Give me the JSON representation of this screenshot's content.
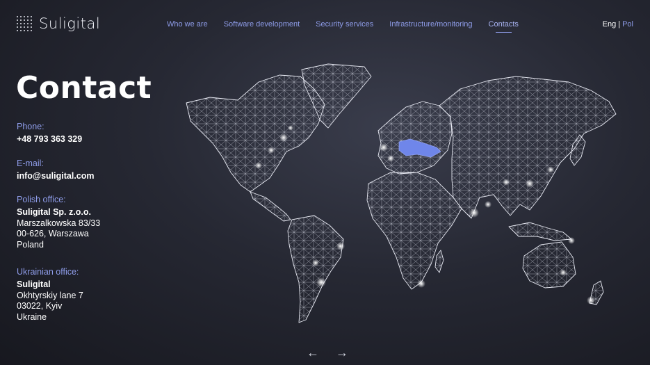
{
  "brand": {
    "name": "Suligital"
  },
  "nav": {
    "items": [
      {
        "label": "Who we are"
      },
      {
        "label": "Software development"
      },
      {
        "label": "Security services"
      },
      {
        "label": "Infrastructure/monitoring"
      },
      {
        "label": "Contacts",
        "active": true
      }
    ]
  },
  "lang": {
    "current": "Eng",
    "separator": "|",
    "other": "Pol"
  },
  "page": {
    "title": "Contact"
  },
  "contact": {
    "phone_label": "Phone:",
    "phone": "+48 793 363 329",
    "email_label": "E-mail:",
    "email": "info@suligital.com",
    "polish": {
      "label": "Polish office:",
      "company": "Suligital Sp. z.o.o.",
      "line1": "Marszalkowska 83/33",
      "line2": "00-626, Warszawa",
      "line3": "Poland"
    },
    "ukrainian": {
      "label": "Ukrainian office:",
      "company": "Suligital",
      "line1": "Okhtyrskiy lane 7",
      "line2": "03022, Kyiv",
      "line3": "Ukraine"
    }
  },
  "pager": {
    "prev": "←",
    "next": "→"
  },
  "colors": {
    "accent": "#8f9dea",
    "highlight_countries": "#6f86ea",
    "background": "#22242e"
  }
}
